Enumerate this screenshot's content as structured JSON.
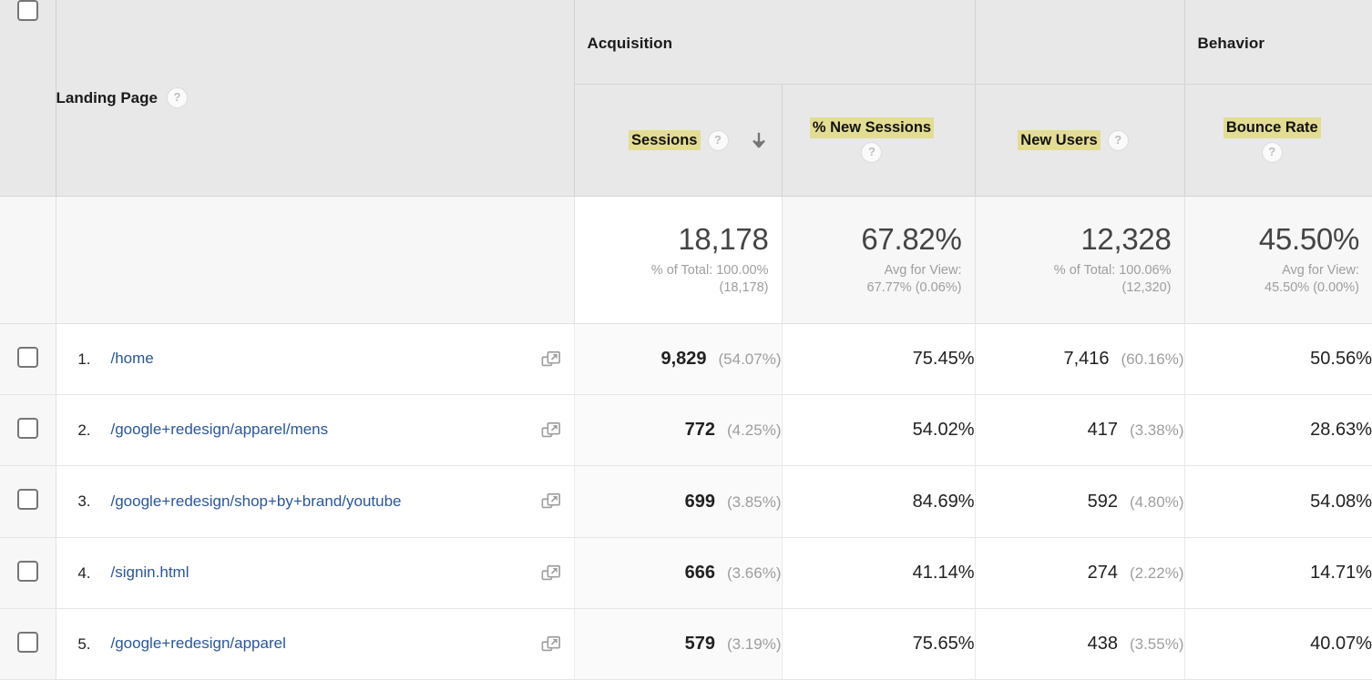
{
  "table": {
    "dimension_header": {
      "label": "Landing Page",
      "help_icon": "help-circle-icon"
    },
    "groups": [
      {
        "label": "Acquisition"
      },
      {
        "label": "Behavior"
      }
    ],
    "metrics": [
      {
        "label": "Sessions",
        "sorted": true,
        "sort_direction": "desc",
        "help_icon": "help-circle-icon"
      },
      {
        "label": "% New Sessions",
        "sorted": false,
        "help_icon": "help-circle-icon"
      },
      {
        "label": "New Users",
        "sorted": false,
        "help_icon": "help-circle-icon"
      },
      {
        "label": "Bounce Rate",
        "sorted": false,
        "help_icon": "help-circle-icon"
      }
    ],
    "summary": [
      {
        "value": "18,178",
        "sub_line1": "% of Total: 100.00%",
        "sub_line2": "(18,178)"
      },
      {
        "value": "67.82%",
        "sub_line1": "Avg for View:",
        "sub_line2": "67.77% (0.06%)"
      },
      {
        "value": "12,328",
        "sub_line1": "% of Total: 100.06%",
        "sub_line2": "(12,320)"
      },
      {
        "value": "45.50%",
        "sub_line1": "Avg for View:",
        "sub_line2": "45.50% (0.00%)"
      }
    ],
    "rows": [
      {
        "index": "1.",
        "page": "/home",
        "sessions": "9,829",
        "sessions_pct": "(54.07%)",
        "new_sessions_pct": "75.45%",
        "new_users": "7,416",
        "new_users_pct": "(60.16%)",
        "bounce_rate": "50.56%"
      },
      {
        "index": "2.",
        "page": "/google+redesign/apparel/mens",
        "sessions": "772",
        "sessions_pct": "(4.25%)",
        "new_sessions_pct": "54.02%",
        "new_users": "417",
        "new_users_pct": "(3.38%)",
        "bounce_rate": "28.63%"
      },
      {
        "index": "3.",
        "page": "/google+redesign/shop+by+brand/youtube",
        "sessions": "699",
        "sessions_pct": "(3.85%)",
        "new_sessions_pct": "84.69%",
        "new_users": "592",
        "new_users_pct": "(4.80%)",
        "bounce_rate": "54.08%"
      },
      {
        "index": "4.",
        "page": "/signin.html",
        "sessions": "666",
        "sessions_pct": "(3.66%)",
        "new_sessions_pct": "41.14%",
        "new_users": "274",
        "new_users_pct": "(2.22%)",
        "bounce_rate": "14.71%"
      },
      {
        "index": "5.",
        "page": "/google+redesign/apparel",
        "sessions": "579",
        "sessions_pct": "(3.19%)",
        "new_sessions_pct": "75.65%",
        "new_users": "438",
        "new_users_pct": "(3.55%)",
        "bounce_rate": "40.07%"
      }
    ],
    "icons": {
      "row_external_link": "open-in-new-window-icon",
      "row_checkbox": "row-checkbox",
      "select_all_checkbox": "select-all-checkbox",
      "sort_arrow": "arrow-down-icon"
    },
    "colors": {
      "highlight": "#e3dc93",
      "link": "#2a5699",
      "header_bg": "#e8e8e8",
      "summary_bg": "#f7f7f7"
    }
  }
}
